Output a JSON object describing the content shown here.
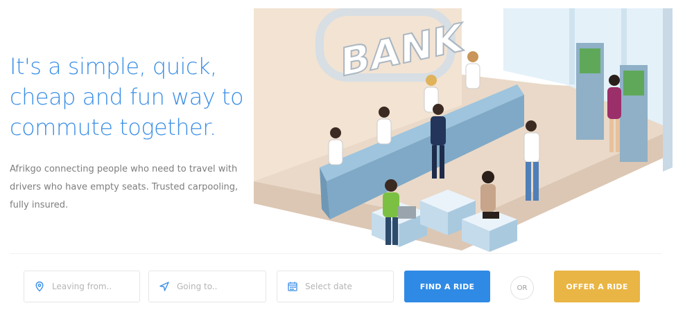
{
  "hero": {
    "headline_lines": [
      "It's a simple, quick,",
      "cheap and fun way to",
      "commute together."
    ],
    "description_lines": [
      "Afrikgo connecting people who need to travel with",
      "drivers who have empty seats. Trusted carpooling,",
      "fully insured."
    ],
    "accent_color": "#3a8ee6"
  },
  "illustration": {
    "sign_text": "BANK"
  },
  "search": {
    "leaving_placeholder": "Leaving from..",
    "going_placeholder": "Going to..",
    "date_placeholder": "Select date",
    "find_label": "FIND A RIDE",
    "or_label": "OR",
    "offer_label": "OFFER A RIDE",
    "find_color": "#2f8ae5",
    "offer_color": "#e9b544",
    "icons": [
      "map-pin-icon",
      "navigation-arrow-icon",
      "calendar-icon"
    ]
  }
}
